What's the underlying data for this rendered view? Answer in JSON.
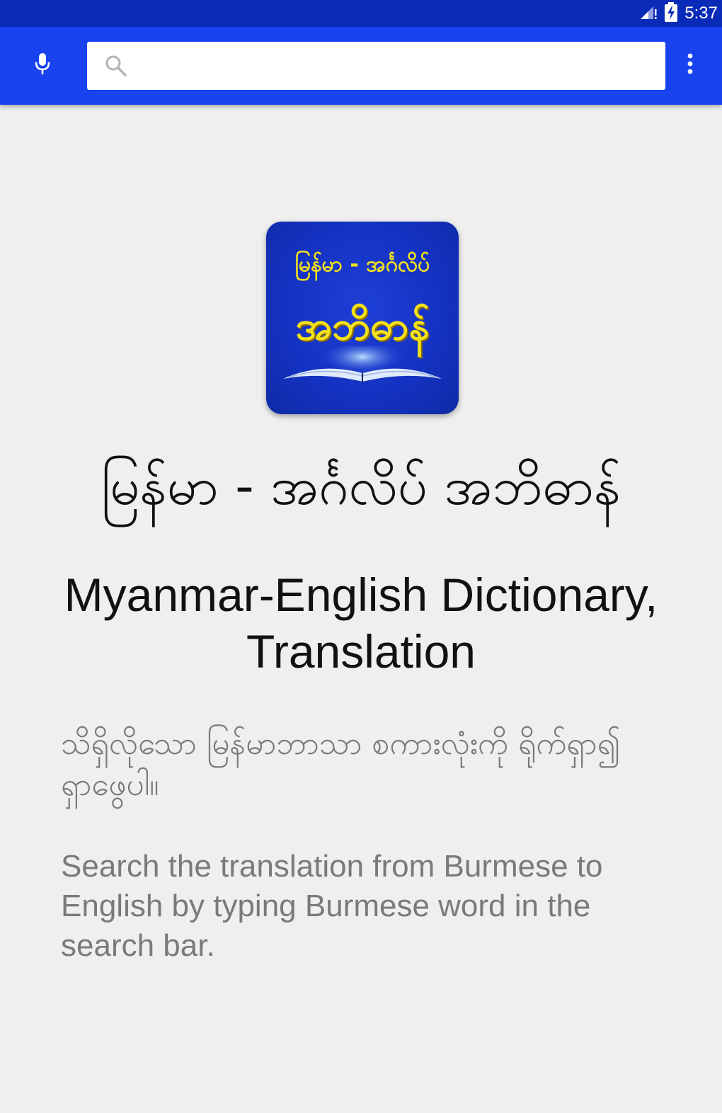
{
  "status_bar": {
    "time": "5:37",
    "icons": [
      "signal-icon",
      "battery-charging-icon"
    ]
  },
  "app_bar": {
    "mic_icon": "mic-icon",
    "search": {
      "value": "",
      "placeholder": "",
      "icon": "search-icon"
    },
    "overflow_icon": "more-vert-icon"
  },
  "colors": {
    "status_bar": "#0a2bb8",
    "app_bar": "#1a43f0",
    "background": "#efefef",
    "logo_text": "#f4e11a"
  },
  "logo": {
    "line1": "မြန်မာ - အင်္ဂလိပ်",
    "line2": "အဘိဓာန်"
  },
  "content": {
    "title_mm": "မြန်မာ - အင်္ဂလိပ် အဘိဓာန်",
    "title_en": "Myanmar-English Dictionary, Translation",
    "description_mm": "သိရှိလိုသော မြန်မာဘာသာ စကားလုံးကို ရိုက်ရှာ၍ ရှာဖွေပါ။",
    "description_en": "Search the translation from Burmese to English by typing Burmese word in the search bar."
  }
}
